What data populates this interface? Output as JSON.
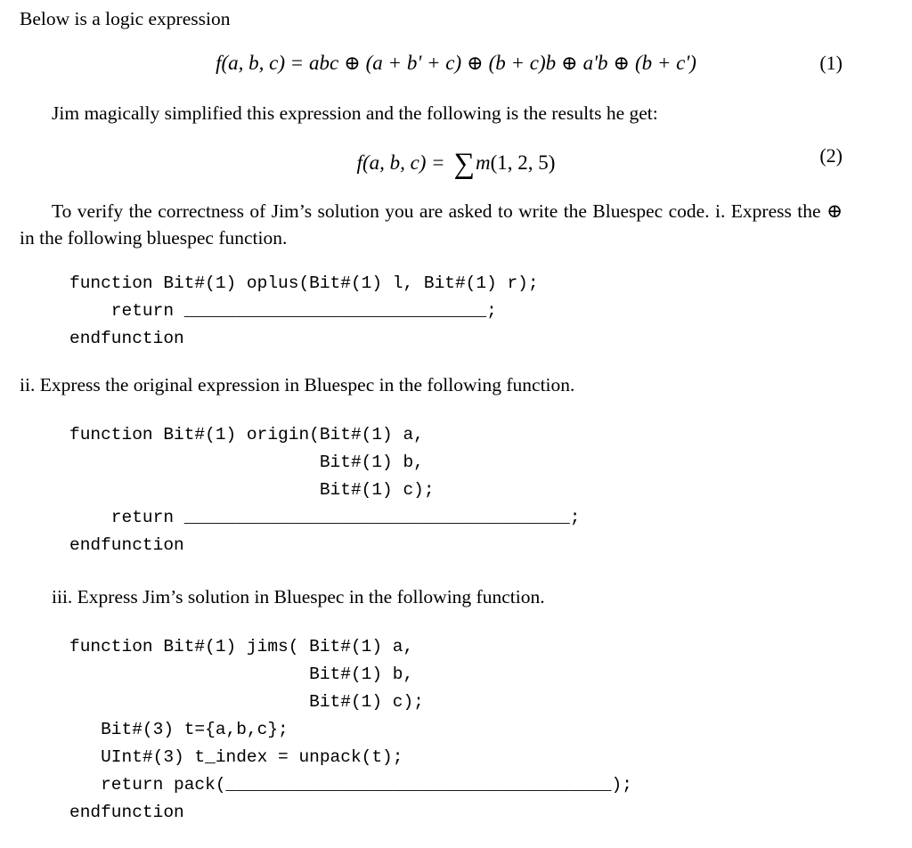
{
  "document": {
    "intro_line": "Below is a logic expression",
    "paragraph_simplified": "Jim magically simplified this expression and the following is the results he get:",
    "paragraph_verify": "To verify the correctness of Jim’s solution you are asked to write the Bluespec code. i. Express the ⊕ in the following bluespec function.",
    "item_ii": "ii. Express the original expression in Bluespec in the following function.",
    "item_iii": "iii. Express Jim’s solution in Bluespec in the following function."
  },
  "equations": [
    {
      "number": "(1)",
      "plain": "f(a, b, c) = abc ⊕ (a + b' + c) ⊕ (b + c)b ⊕ a'b ⊕ (b + c')",
      "lhs_f": "f",
      "lhs_args": "(a, b, c)",
      "eq": "=",
      "term1": "abc",
      "op1": "⊕",
      "term2": "(a + b' + c)",
      "op2": "⊕",
      "term3": "(b + c)b",
      "op3": "⊕",
      "term4": "a'b",
      "op4": "⊕",
      "term5": "(b + c')"
    },
    {
      "number": "(2)",
      "plain": "f(a, b, c) = ∑ m(1, 2, 5)",
      "lhs_f": "f",
      "lhs_args": "(a, b, c)",
      "eq": "=",
      "sum_symbol": "∑",
      "minterm_fn": "m",
      "minterms": "(1, 2, 5)"
    }
  ],
  "code_blocks": [
    {
      "id": "oplus",
      "lines": [
        "function Bit#(1) oplus(Bit#(1) l, Bit#(1) r);",
        "    return _____________________________;",
        "endfunction"
      ]
    },
    {
      "id": "origin",
      "lines": [
        "function Bit#(1) origin(Bit#(1) a,",
        "                        Bit#(1) b,",
        "                        Bit#(1) c);",
        "    return _____________________________________;",
        "endfunction"
      ]
    },
    {
      "id": "jims",
      "lines": [
        "function Bit#(1) jims( Bit#(1) a,",
        "                       Bit#(1) b,",
        "                       Bit#(1) c);",
        "   Bit#(3) t={a,b,c};",
        "   UInt#(3) t_index = unpack(t);",
        "   return pack(_____________________________________);",
        "endfunction"
      ]
    }
  ],
  "colors": {
    "page_background": "#ffffff",
    "text": "#000000"
  }
}
